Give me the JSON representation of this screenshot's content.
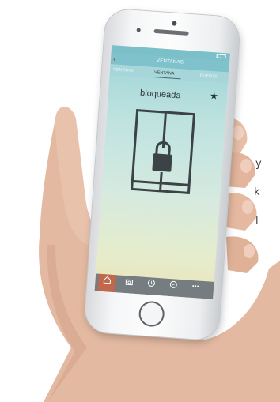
{
  "side_text": [
    "y",
    "k",
    "l"
  ],
  "app": {
    "status_bar": {
      "carrier": "",
      "time": ""
    },
    "nav_title": "VENTANAS",
    "tabs": {
      "left": "VENTANA",
      "center": "VENTANA",
      "right": "PUERTA"
    },
    "state_label": "bloqueada",
    "state_icon": "padlock-icon",
    "tab_bar": [
      {
        "icon": "home-icon",
        "label": ""
      },
      {
        "icon": "camera-icon",
        "label": ""
      },
      {
        "icon": "clock-icon",
        "label": ""
      },
      {
        "icon": "share-icon",
        "label": ""
      },
      {
        "icon": "more-icon",
        "label": ""
      }
    ]
  },
  "colors": {
    "accent": "#c5402f",
    "nav_bar": "#7fc2cb",
    "tab_bar": "#767d80",
    "home_tab": "#c0674c"
  }
}
